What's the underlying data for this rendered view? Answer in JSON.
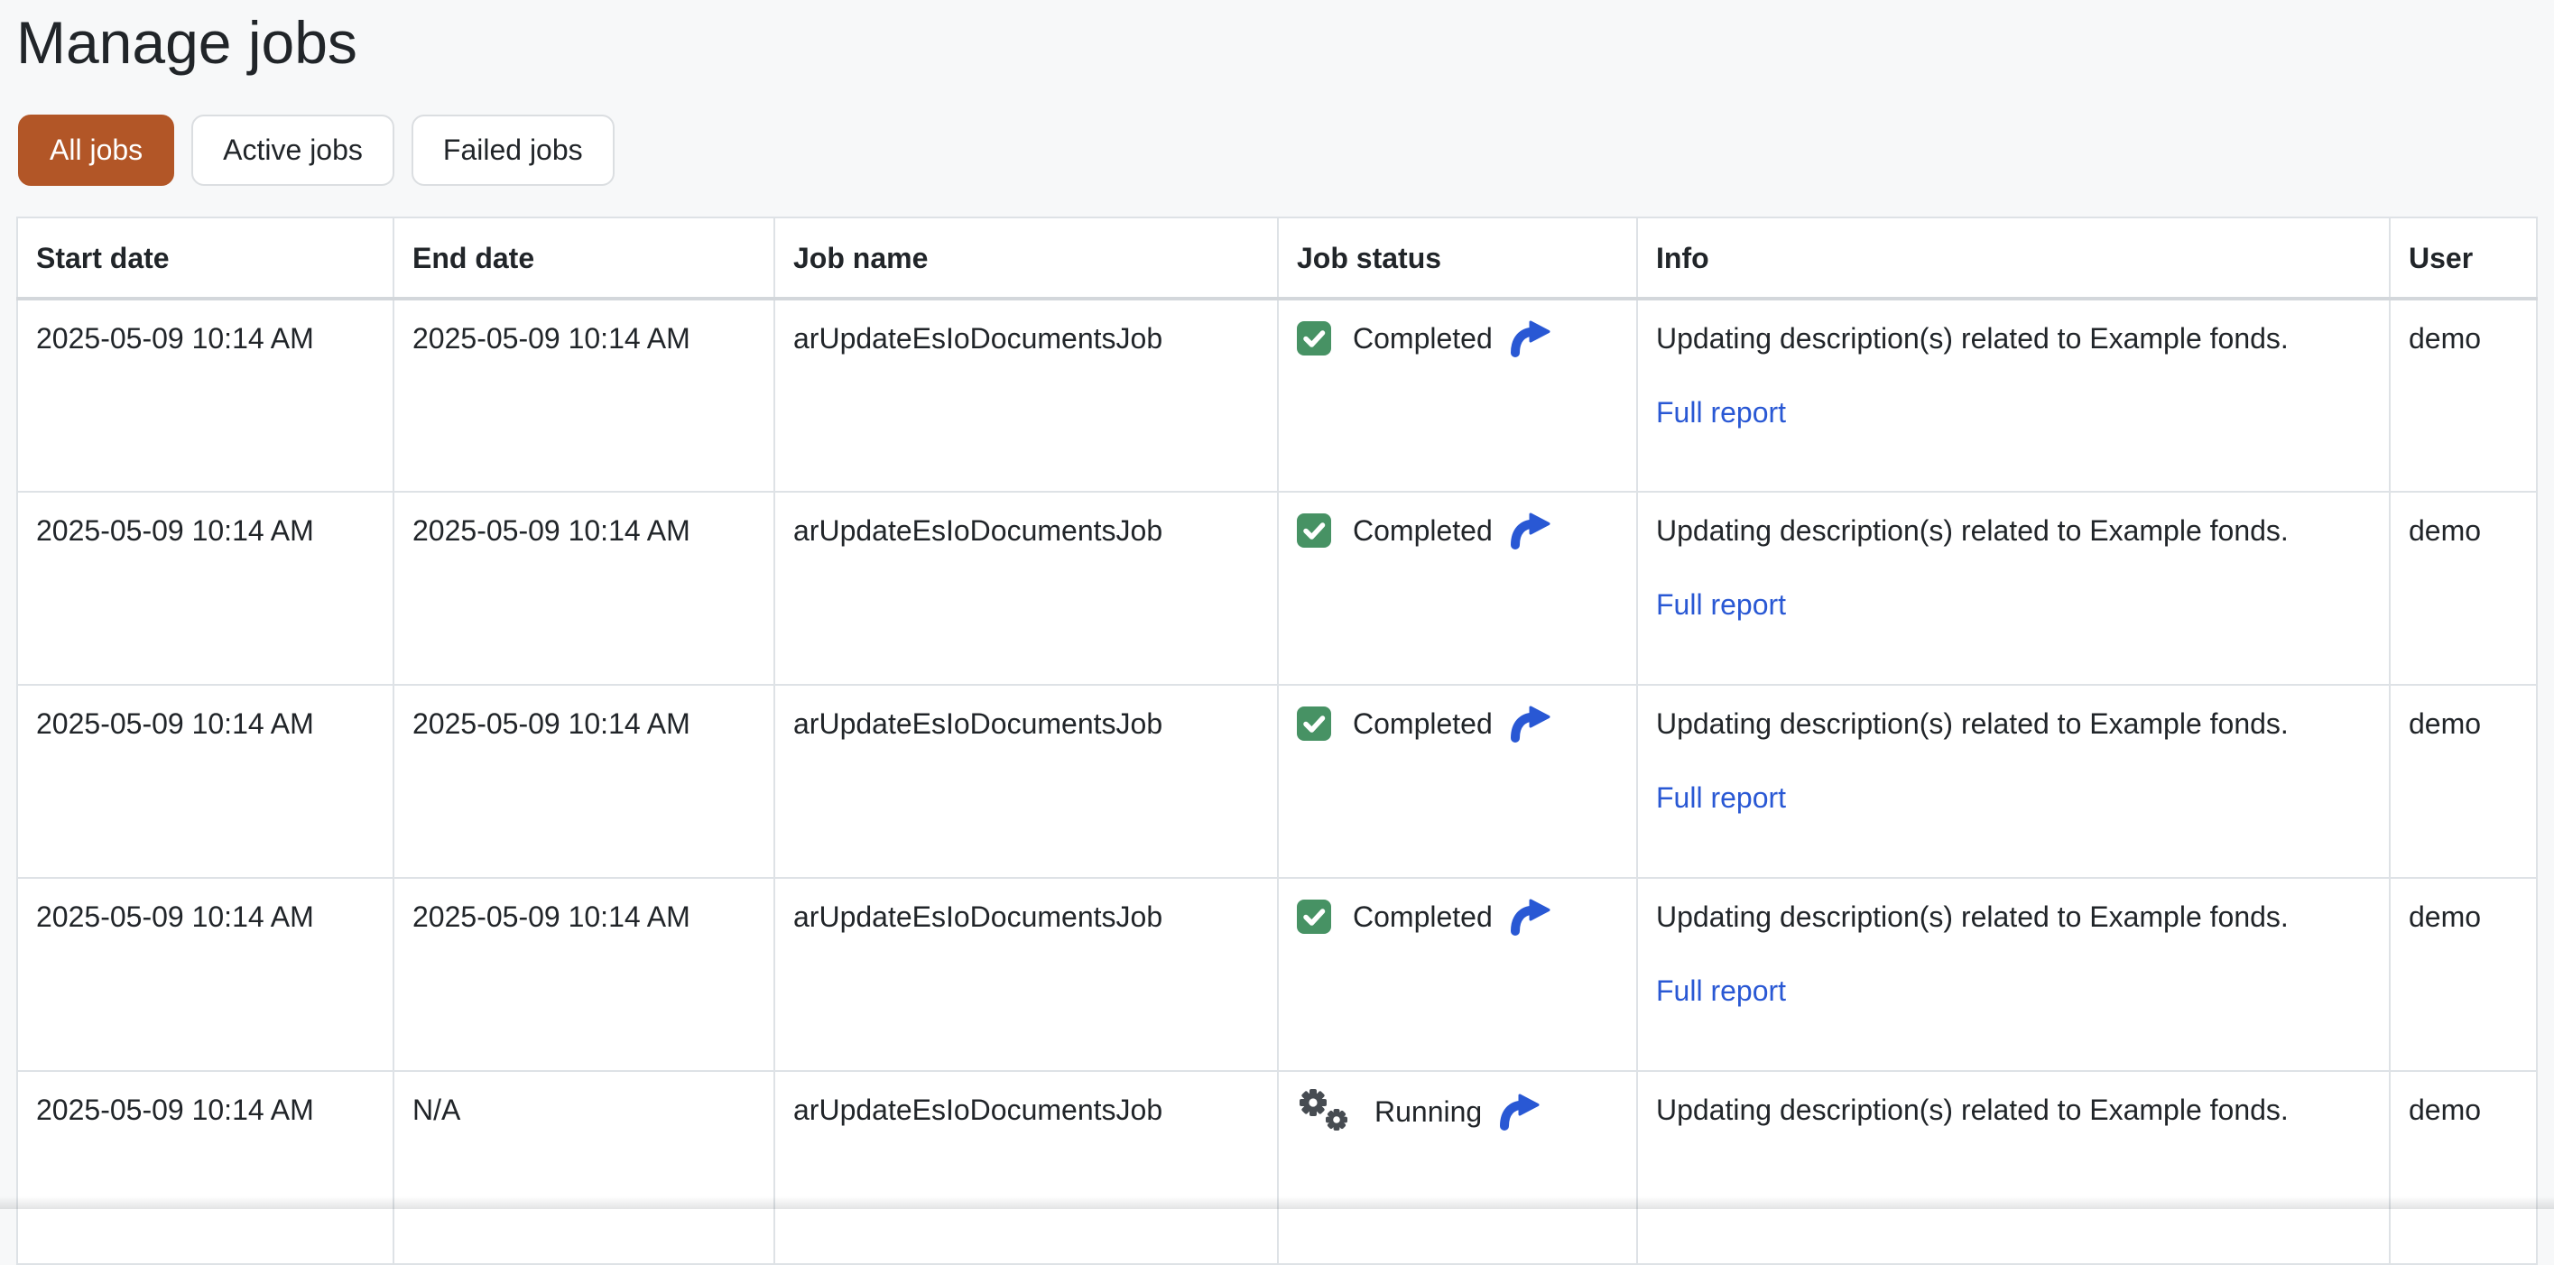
{
  "page": {
    "title": "Manage jobs"
  },
  "colors": {
    "accent": "#b25627",
    "page_bg": "#f7f8f9",
    "text": "#212529",
    "border": "#dee2e6",
    "success_green": "#479264",
    "link_blue": "#2958d4",
    "gear_gray": "#474c52"
  },
  "filters": {
    "items": [
      {
        "label": "All jobs",
        "active": true
      },
      {
        "label": "Active jobs",
        "active": false
      },
      {
        "label": "Failed jobs",
        "active": false
      }
    ]
  },
  "table": {
    "columns": [
      "Start date",
      "End date",
      "Job name",
      "Job status",
      "Info",
      "User"
    ],
    "rows": [
      {
        "start_date": "2025-05-09 10:14 AM",
        "end_date": "2025-05-09 10:14 AM",
        "job_name": "arUpdateEsIoDocumentsJob",
        "status": {
          "label": "Completed",
          "icon": "check-square"
        },
        "info": {
          "description": "Updating description(s) related to Example fonds.",
          "link": "Full report"
        },
        "user": "demo"
      },
      {
        "start_date": "2025-05-09 10:14 AM",
        "end_date": "2025-05-09 10:14 AM",
        "job_name": "arUpdateEsIoDocumentsJob",
        "status": {
          "label": "Completed",
          "icon": "check-square"
        },
        "info": {
          "description": "Updating description(s) related to Example fonds.",
          "link": "Full report"
        },
        "user": "demo"
      },
      {
        "start_date": "2025-05-09 10:14 AM",
        "end_date": "2025-05-09 10:14 AM",
        "job_name": "arUpdateEsIoDocumentsJob",
        "status": {
          "label": "Completed",
          "icon": "check-square"
        },
        "info": {
          "description": "Updating description(s) related to Example fonds.",
          "link": "Full report"
        },
        "user": "demo"
      },
      {
        "start_date": "2025-05-09 10:14 AM",
        "end_date": "2025-05-09 10:14 AM",
        "job_name": "arUpdateEsIoDocumentsJob",
        "status": {
          "label": "Completed",
          "icon": "check-square"
        },
        "info": {
          "description": "Updating description(s) related to Example fonds.",
          "link": "Full report"
        },
        "user": "demo"
      },
      {
        "start_date": "2025-05-09 10:14 AM",
        "end_date": "N/A",
        "job_name": "arUpdateEsIoDocumentsJob",
        "status": {
          "label": "Running",
          "icon": "gears"
        },
        "info": {
          "description": "Updating description(s) related to Example fonds."
        },
        "user": "demo"
      }
    ]
  }
}
